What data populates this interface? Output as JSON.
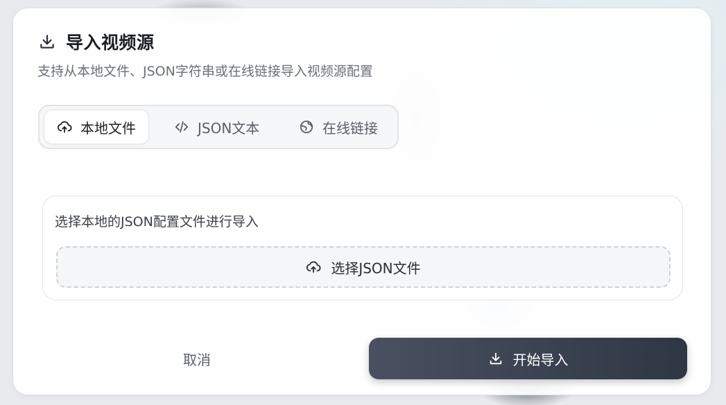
{
  "dialog": {
    "title": "导入视频源",
    "title_icon": "download-icon",
    "subtitle": "支持从本地文件、JSON字符串或在线链接导入视频源配置"
  },
  "tabs": [
    {
      "label": "本地文件",
      "icon": "upload-cloud-icon",
      "active": true
    },
    {
      "label": "JSON文本",
      "icon": "code-icon",
      "active": false
    },
    {
      "label": "在线链接",
      "icon": "globe-icon",
      "active": false
    }
  ],
  "panel": {
    "description": "选择本地的JSON配置文件进行导入",
    "select_button_label": "选择JSON文件",
    "select_button_icon": "upload-cloud-icon"
  },
  "footer": {
    "cancel_label": "取消",
    "start_label": "开始导入",
    "start_icon": "download-icon"
  },
  "colors": {
    "primary_button_start": "#4a5060",
    "primary_button_end": "#2f3644",
    "title_text": "#1c1f24",
    "muted_text": "#6b7078"
  }
}
